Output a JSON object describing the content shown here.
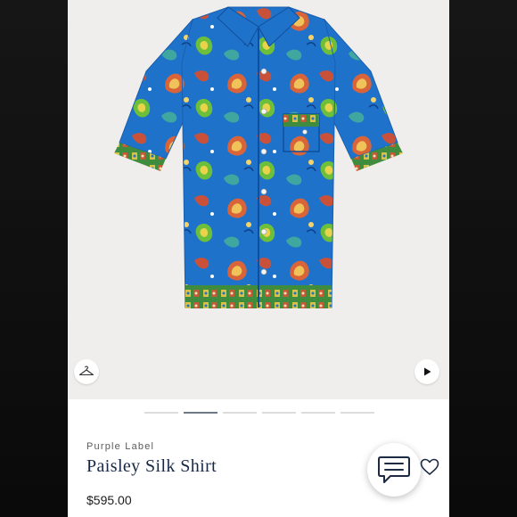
{
  "product": {
    "brand": "Purple Label",
    "name": "Paisley Silk Shirt",
    "price": "$595.00"
  },
  "gallery": {
    "image_count": 6,
    "active_index": 1,
    "icons": [
      "hanger-icon",
      "play-icon"
    ]
  },
  "actions": {
    "chat_icon": "chat-bubble-icon",
    "favorite_icon": "heart-icon"
  },
  "colors": {
    "shirt_base": "#1f72c9",
    "title": "#172846",
    "active_dot": "#6f7986"
  }
}
